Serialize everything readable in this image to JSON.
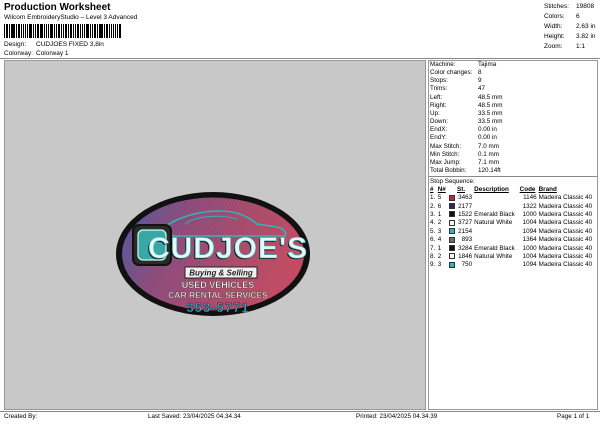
{
  "header": {
    "title": "Production Worksheet",
    "subtitle": "Wilcom EmbroideryStudio – Level 3 Advanced",
    "design_label": "Design:",
    "design_value": "CUDJOES FIXED 3,8in",
    "colorway_label": "Colorway:",
    "colorway_value": "Colorway 1"
  },
  "stats": [
    {
      "label": "Stitches:",
      "value": "19808"
    },
    {
      "label": "Colors:",
      "value": "6"
    },
    {
      "label": "Width:",
      "value": "2.63 in"
    },
    {
      "label": "Height:",
      "value": "3.82 in"
    },
    {
      "label": "Zoom:",
      "value": "1:1"
    }
  ],
  "machine_info": [
    {
      "label": "Machine:",
      "value": "Tajima"
    },
    {
      "label": "Color changes:",
      "value": "8"
    },
    {
      "label": "Stops:",
      "value": "9"
    },
    {
      "label": "Trims:",
      "value": "47"
    },
    {
      "label": "Left:",
      "value": "48.5 mm"
    },
    {
      "label": "Right:",
      "value": "48.5 mm"
    },
    {
      "label": "Up:",
      "value": "33.5 mm"
    },
    {
      "label": "Down:",
      "value": "33.5 mm"
    },
    {
      "label": "EndX:",
      "value": "0.00 in"
    },
    {
      "label": "EndY:",
      "value": "0.00 in"
    },
    {
      "label": "Max Stitch:",
      "value": "7.0 mm"
    },
    {
      "label": "Min Stitch:",
      "value": "0.1 mm"
    },
    {
      "label": "Max Jump:",
      "value": "7.1 mm"
    },
    {
      "label": "Total Bobbin:",
      "value": "120.14ft"
    }
  ],
  "stop_sequence": {
    "title": "Stop Sequence:",
    "headers": {
      "n": "#",
      "no": "N#",
      "st": "St.",
      "description": "Description",
      "code": "Code",
      "brand": "Brand"
    },
    "rows": [
      {
        "n": "1.",
        "no": "5",
        "color": "#c0283a",
        "st": "3463",
        "description": "",
        "code": "1146",
        "brand": "Madeira Classic 40"
      },
      {
        "n": "2.",
        "no": "6",
        "color": "#2a2a6a",
        "st": "2177",
        "description": "",
        "code": "1322",
        "brand": "Madeira Classic 40"
      },
      {
        "n": "3.",
        "no": "1",
        "color": "#111111",
        "st": "1522",
        "description": "Emerald Black",
        "code": "1000",
        "brand": "Madeira Classic 40"
      },
      {
        "n": "4.",
        "no": "2",
        "color": "#f4f4f4",
        "st": "3727",
        "description": "Natural White",
        "code": "1004",
        "brand": "Madeira Classic 40"
      },
      {
        "n": "5.",
        "no": "3",
        "color": "#2fb6b6",
        "st": "2154",
        "description": "",
        "code": "1094",
        "brand": "Madeira Classic 40"
      },
      {
        "n": "6.",
        "no": "4",
        "color": "#6a6a6a",
        "st": "893",
        "description": "",
        "code": "1364",
        "brand": "Madeira Classic 40"
      },
      {
        "n": "7.",
        "no": "1",
        "color": "#111111",
        "st": "3284",
        "description": "Emerald Black",
        "code": "1000",
        "brand": "Madeira Classic 40"
      },
      {
        "n": "8.",
        "no": "2",
        "color": "#f4f4f4",
        "st": "1846",
        "description": "Natural White",
        "code": "1004",
        "brand": "Madeira Classic 40"
      },
      {
        "n": "9.",
        "no": "3",
        "color": "#2fb6b6",
        "st": "750",
        "description": "",
        "code": "1094",
        "brand": "Madeira Classic 40"
      }
    ]
  },
  "design_preview": {
    "name_text": "CUDJOE'S",
    "tagline": "Buying & Selling",
    "line1": "USED VEHICLES",
    "line2": "CAR RENTAL SERVICES",
    "phone": "353-5771"
  },
  "footer": {
    "created_by": "Created By:",
    "last_saved": "Last Saved: 23/04/2025 04.34.34",
    "printed": "Printed: 23/04/2025 04.34.39",
    "page": "Page 1 of 1"
  }
}
